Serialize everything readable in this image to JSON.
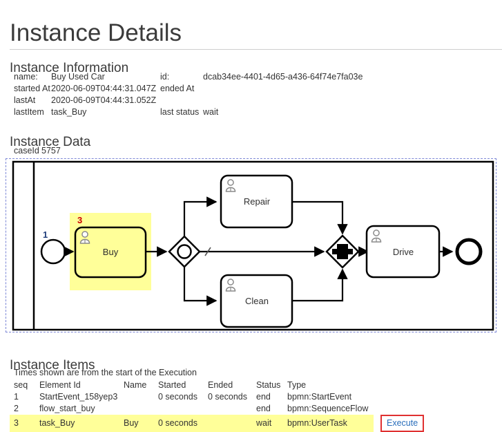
{
  "page": {
    "title": "Instance Details"
  },
  "instance_information": {
    "heading": "Instance Information",
    "rows": [
      {
        "key1": "name:",
        "val1": "Buy Used Car",
        "key2": "id:",
        "val2": "dcab34ee-4401-4d65-a436-64f74e7fa03e"
      },
      {
        "key1": "started At",
        "val1": "2020-06-09T04:44:31.047Z",
        "key2": "ended At",
        "val2": ""
      },
      {
        "key1": "lastAt",
        "val1": "2020-06-09T04:44:31.052Z",
        "key2": "",
        "val2": ""
      },
      {
        "key1": "lastItem",
        "val1": "task_Buy",
        "key2": "last status",
        "val2": "wait"
      }
    ]
  },
  "instance_data": {
    "heading": "Instance Data",
    "rows": [
      {
        "key": "caseId",
        "value": "5757"
      }
    ]
  },
  "diagram": {
    "type": "bpmn",
    "highlight_color": "#ffff99",
    "marker_color": "#cc0000",
    "token_color": "#1f3d7a",
    "pool_border": "#000000",
    "nodes": [
      {
        "id": "StartEvent_158yep3",
        "type": "startEvent",
        "label": "",
        "marker": "1"
      },
      {
        "id": "task_Buy",
        "type": "userTask",
        "label": "Buy",
        "marker": "3",
        "highlighted": true
      },
      {
        "id": "gateway_split",
        "type": "inclusiveGateway",
        "label": ""
      },
      {
        "id": "task_Repair",
        "type": "userTask",
        "label": "Repair"
      },
      {
        "id": "task_Clean",
        "type": "userTask",
        "label": "Clean"
      },
      {
        "id": "gateway_join",
        "type": "parallelGateway",
        "label": ""
      },
      {
        "id": "task_Drive",
        "type": "userTask",
        "label": "Drive"
      },
      {
        "id": "EndEvent",
        "type": "endEvent",
        "label": ""
      }
    ]
  },
  "instance_items": {
    "heading": "Instance Items",
    "note": "Times shown are from the start of the Execution",
    "columns": [
      "seq",
      "Element Id",
      "Name",
      "Started",
      "Ended",
      "Status",
      "Type",
      ""
    ],
    "rows": [
      {
        "seq": "1",
        "element_id": "StartEvent_158yep3",
        "name": "",
        "started": "0 seconds",
        "ended": "0 seconds",
        "status": "end",
        "type": "bpmn:StartEvent",
        "action": "",
        "highlighted": false
      },
      {
        "seq": "2",
        "element_id": "flow_start_buy",
        "name": "",
        "started": "",
        "ended": "",
        "status": "end",
        "type": "bpmn:SequenceFlow",
        "action": "",
        "highlighted": false
      },
      {
        "seq": "3",
        "element_id": "task_Buy",
        "name": "Buy",
        "started": "0 seconds",
        "ended": "",
        "status": "wait",
        "type": "bpmn:UserTask",
        "action": "Execute",
        "highlighted": true
      }
    ]
  }
}
